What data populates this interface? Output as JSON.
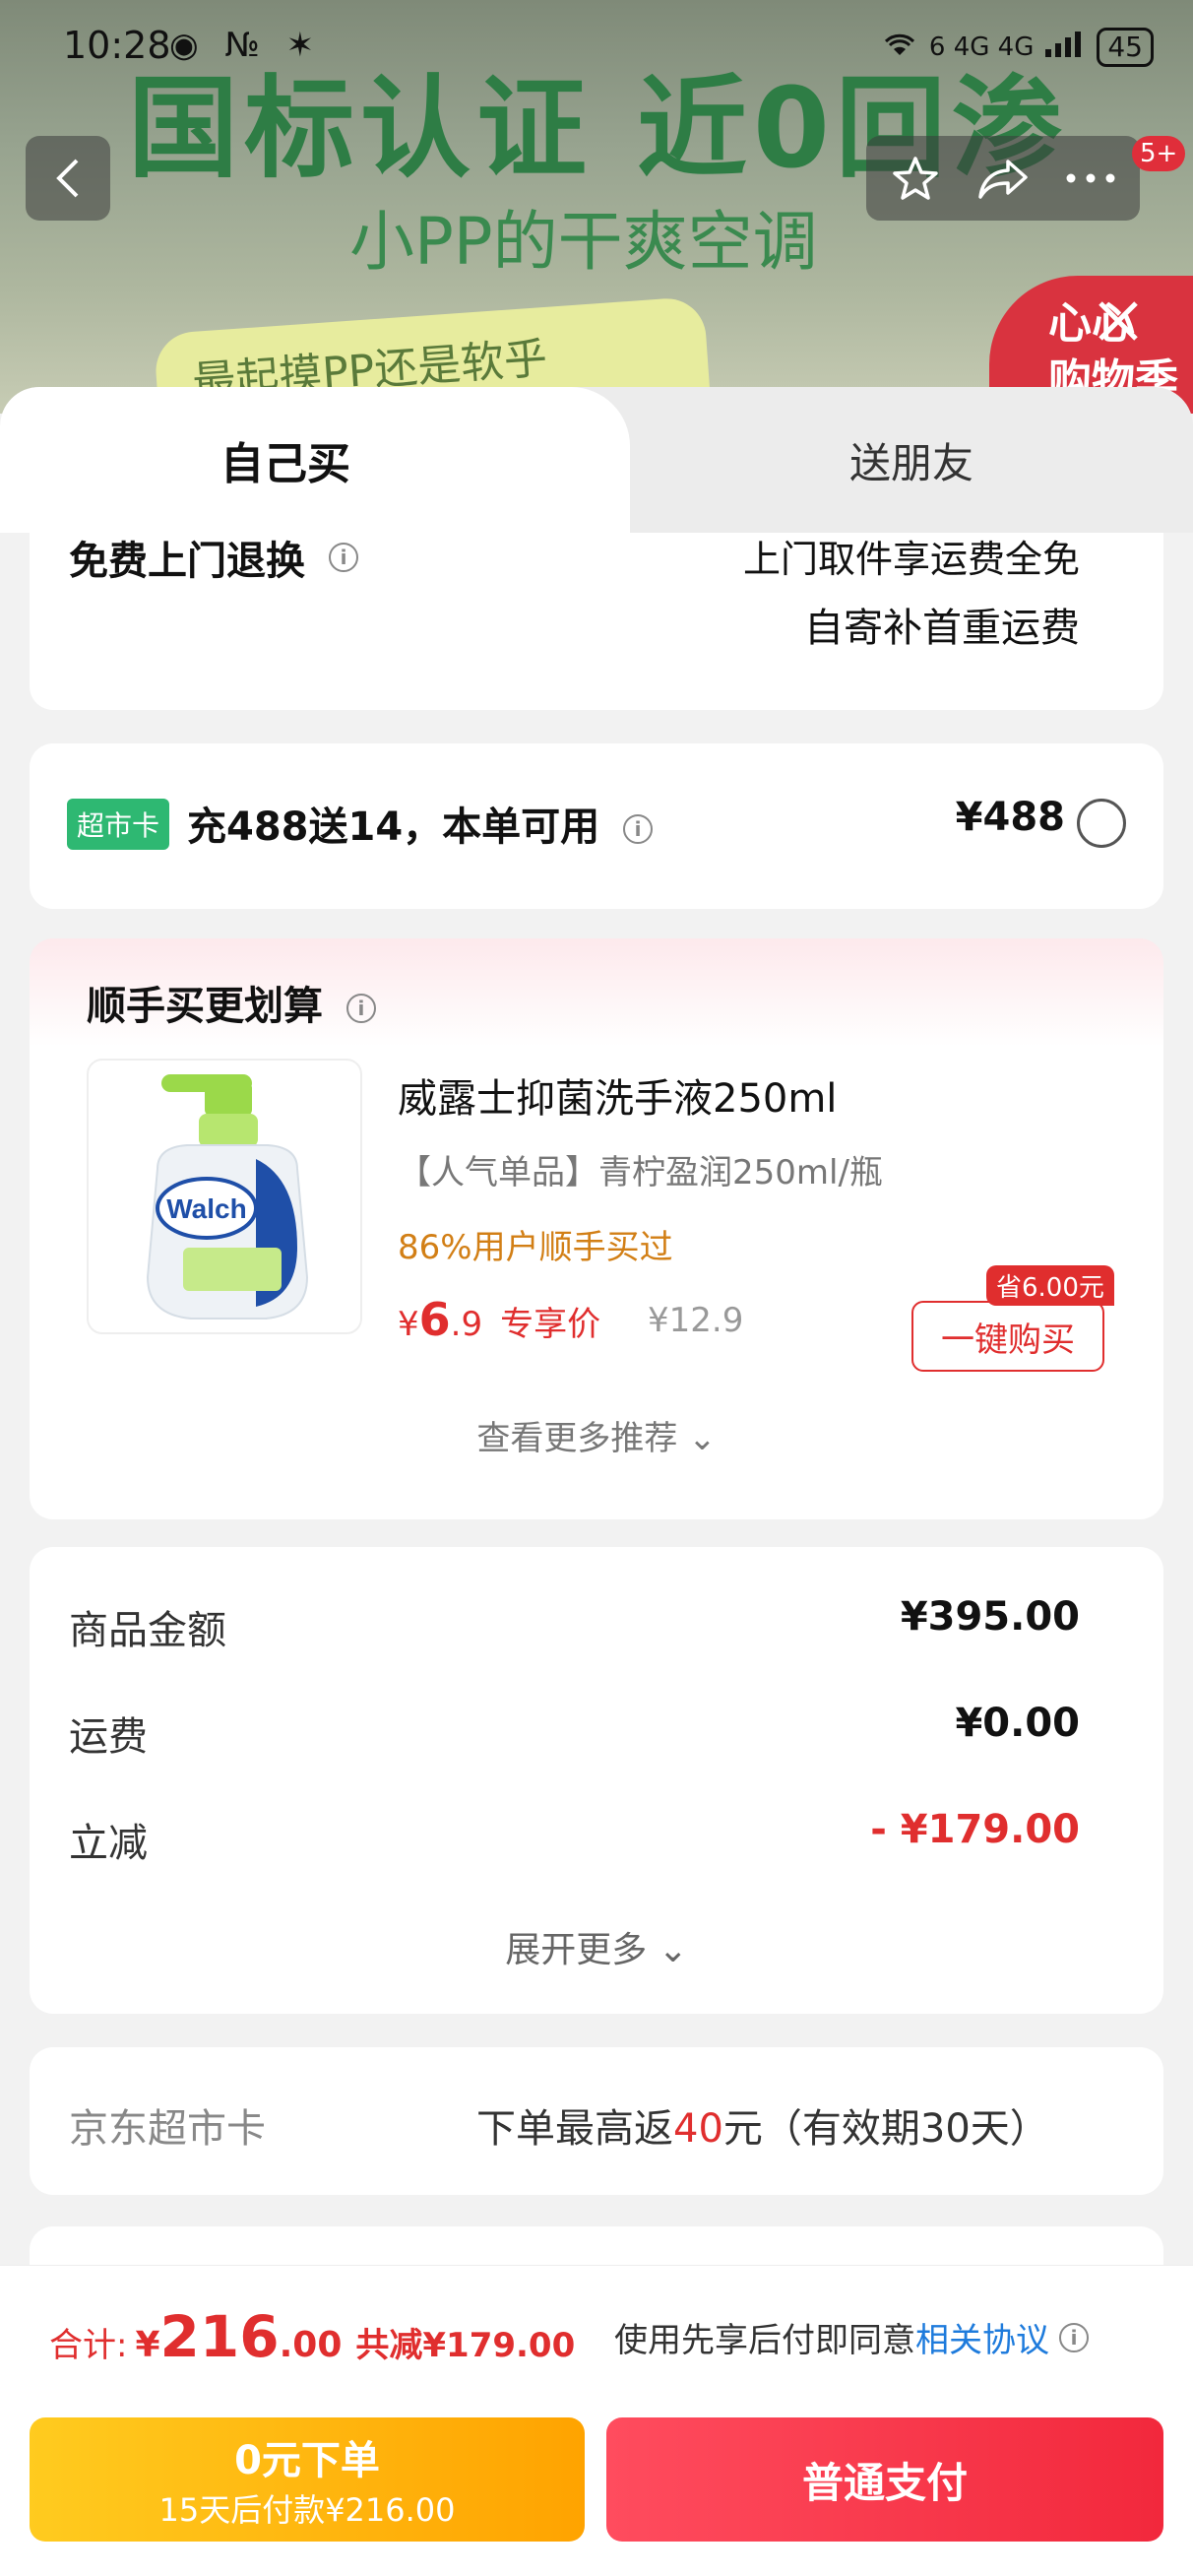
{
  "status_bar": {
    "time": "10:28",
    "left_icons": "◉ № ✶",
    "signal_labels": "6 4G 4G",
    "battery": "45"
  },
  "banner": {
    "headline": "国标认证 近0回渗",
    "subheadline": "小PP的干爽空调",
    "wave_text": "最起摸PP还是软乎",
    "badge_text_line1": "心心",
    "badge_text_line2": "购物季",
    "notification_count": "5+"
  },
  "tabs": {
    "self": "自己买",
    "friend": "送朋友"
  },
  "return_card": {
    "left_label": "免费上门退换",
    "right_line1": "上门取件享运费全免",
    "right_line2": "自寄补首重运费"
  },
  "supermarket_card": {
    "tag": "超市卡",
    "text": "充488送14，本单可用",
    "price": "¥488"
  },
  "recommend": {
    "title": "顺手买更划算",
    "product_name": "威露士抑菌洗手液250ml",
    "product_spec": "【人气单品】青柠盈润250ml/瓶",
    "social_proof": "86%用户顺手买过",
    "price_yen": "¥",
    "price_int": "6",
    "price_dec": ".9",
    "price_tag": "专享价",
    "original_price": "¥12.9",
    "save_badge": "省6.00元",
    "buy_button": "一键购买",
    "more": "查看更多推荐 ⌄",
    "brand_on_bottle": "Walch"
  },
  "amounts": {
    "goods_label": "商品金额",
    "goods_value": "¥395.00",
    "shipping_label": "运费",
    "shipping_value": "¥0.00",
    "discount_label": "立减",
    "discount_value": "- ¥179.00",
    "expand": "展开更多 ⌄"
  },
  "jd_card": {
    "label": "京东超市卡",
    "text_prefix": "下单最高返",
    "text_amount": "40",
    "text_suffix": "元（有效期30天）"
  },
  "bottom": {
    "total_label": "合计:",
    "total_yen": "¥",
    "total_int": "216",
    "total_dec": ".00",
    "total_reduce": "共减¥179.00",
    "agree_prefix": "使用先享后付即同意",
    "agree_link": "相关协议",
    "pay_later_title": "0元下单",
    "pay_later_sub": "15天后付款¥216.00",
    "pay_normal": "普通支付"
  },
  "colors": {
    "accent_red": "#e02e2e",
    "green_tag": "#2eb872",
    "pay_later_yellow": "#ffa300",
    "pay_normal_red": "#f2283c",
    "link_blue": "#1e7bdc"
  }
}
